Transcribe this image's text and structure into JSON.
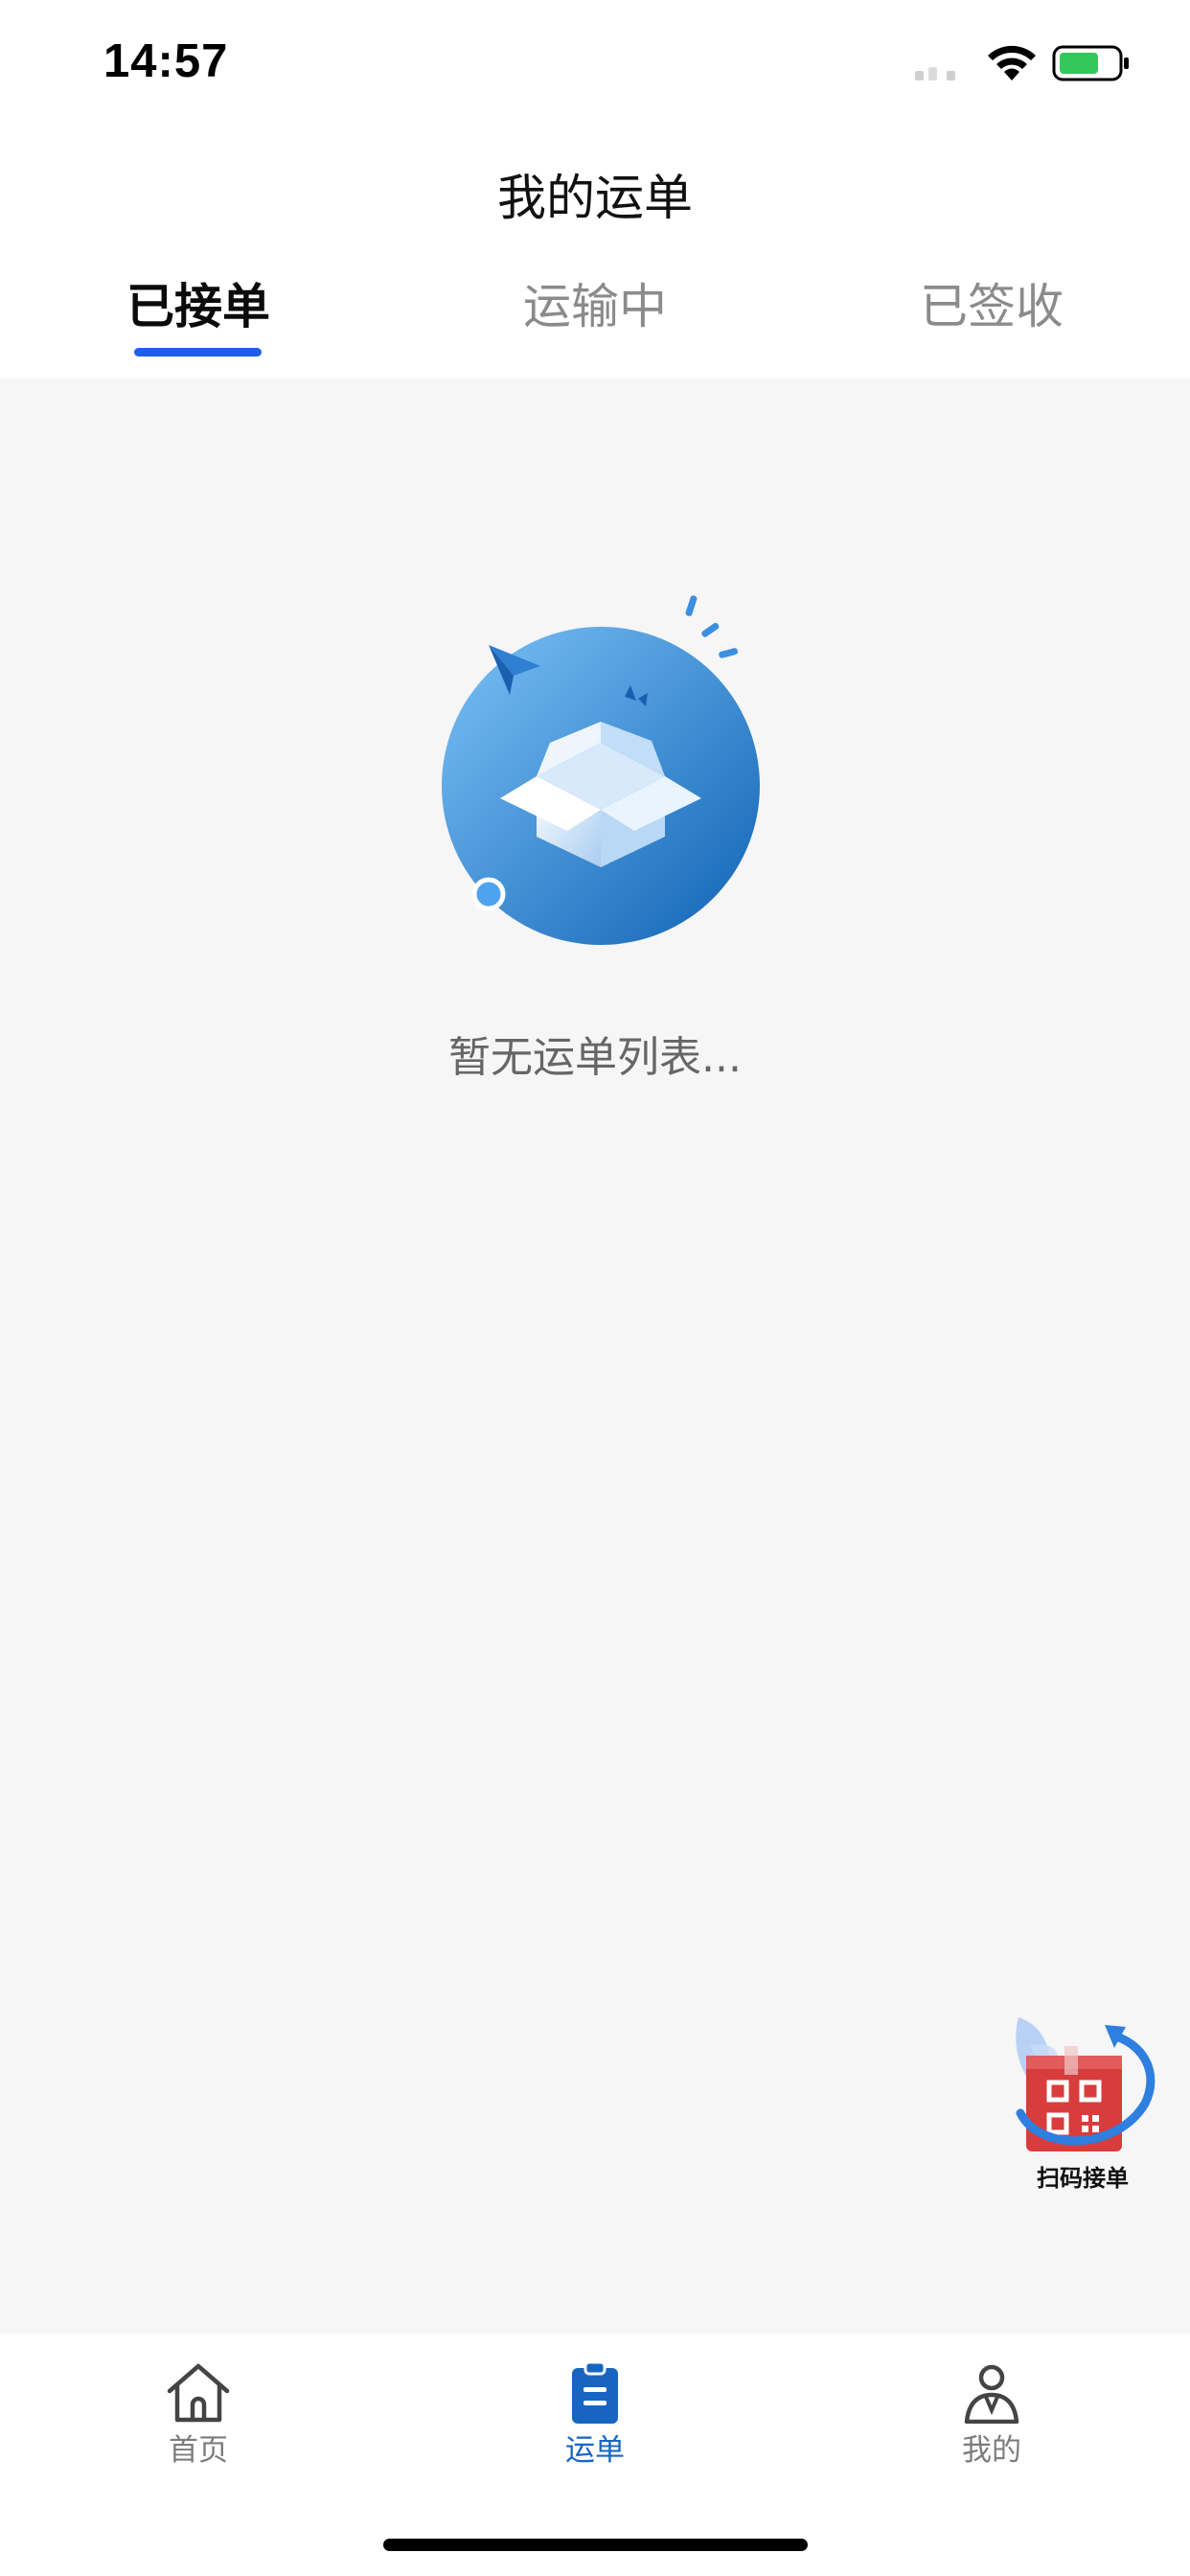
{
  "status_bar": {
    "time": "14:57"
  },
  "header": {
    "title": "我的运单"
  },
  "tabs": [
    {
      "label": "已接单",
      "active": true
    },
    {
      "label": "运输中",
      "active": false
    },
    {
      "label": "已签收",
      "active": false
    }
  ],
  "empty_state": {
    "icon": "empty-box-illustration",
    "message": "暂无运单列表..."
  },
  "scan_button": {
    "icon": "qr-code-icon",
    "label": "扫码接单"
  },
  "tabbar": {
    "items": [
      {
        "label": "首页",
        "icon": "home-icon",
        "active": false
      },
      {
        "label": "运单",
        "icon": "clipboard-icon",
        "active": true
      },
      {
        "label": "我的",
        "icon": "person-icon",
        "active": false
      }
    ]
  },
  "colors": {
    "accent": "#1f5fe8",
    "active_tab_bar": "#1765c1",
    "background": "#f6f6f7",
    "scan_button_red": "#d93c3c"
  }
}
